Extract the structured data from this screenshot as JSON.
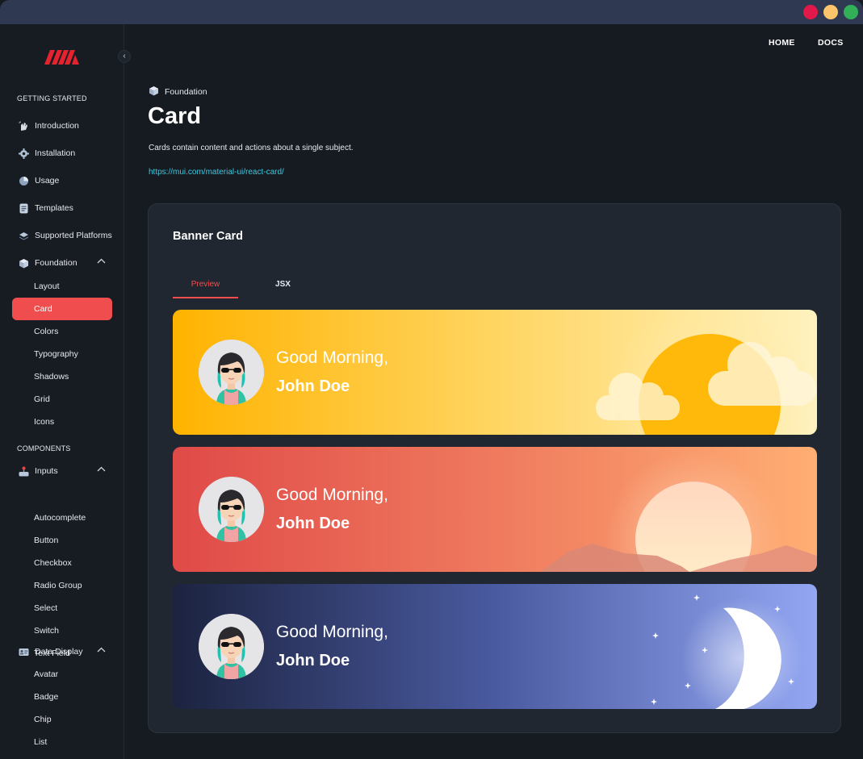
{
  "nav": {
    "home": "HOME",
    "docs": "DOCS"
  },
  "sidebar": {
    "collapse": "‹",
    "sections": [
      {
        "title": "GETTING STARTED",
        "items": [
          {
            "label": "Introduction",
            "icon": "hand-wave-icon"
          },
          {
            "label": "Installation",
            "icon": "gear-icon"
          },
          {
            "label": "Usage",
            "icon": "pie-chart-icon"
          },
          {
            "label": "Templates",
            "icon": "document-icon"
          },
          {
            "label": "Supported Platforms",
            "icon": "layers-icon"
          },
          {
            "label": "Foundation",
            "icon": "cube-icon"
          }
        ]
      },
      {
        "title": "COMPONENTS",
        "items": [
          {
            "label": "Inputs",
            "icon": "joystick-icon"
          },
          {
            "label": "Data Display",
            "icon": "id-card-icon"
          }
        ]
      }
    ],
    "foundation_children": [
      "Layout",
      "Card",
      "Colors",
      "Typography",
      "Shadows",
      "Grid",
      "Icons"
    ],
    "inputs_children": [
      "Autocomplete",
      "Button",
      "Checkbox",
      "Radio Group",
      "Select",
      "Switch",
      "Text Field"
    ],
    "data_display_children": [
      "Avatar",
      "Badge",
      "Chip",
      "List"
    ],
    "active": "Card"
  },
  "page": {
    "breadcrumb": "Foundation",
    "title": "Card",
    "description": "Cards contain content and actions about a single subject.",
    "link": "https://mui.com/material-ui/react-card/"
  },
  "panel": {
    "title": "Banner Card",
    "tabs": [
      "Preview",
      "JSX"
    ],
    "active_tab": "Preview"
  },
  "banners": [
    {
      "theme": "sunny",
      "greeting": "Good Morning,",
      "name": "John Doe"
    },
    {
      "theme": "sunset",
      "greeting": "Good Morning,",
      "name": "John Doe"
    },
    {
      "theme": "night",
      "greeting": "Good Morning,",
      "name": "John Doe"
    }
  ],
  "colors": {
    "accent": "#f04e4e",
    "link": "#3ec9e0",
    "background": "#161b22",
    "panel": "#202731"
  }
}
